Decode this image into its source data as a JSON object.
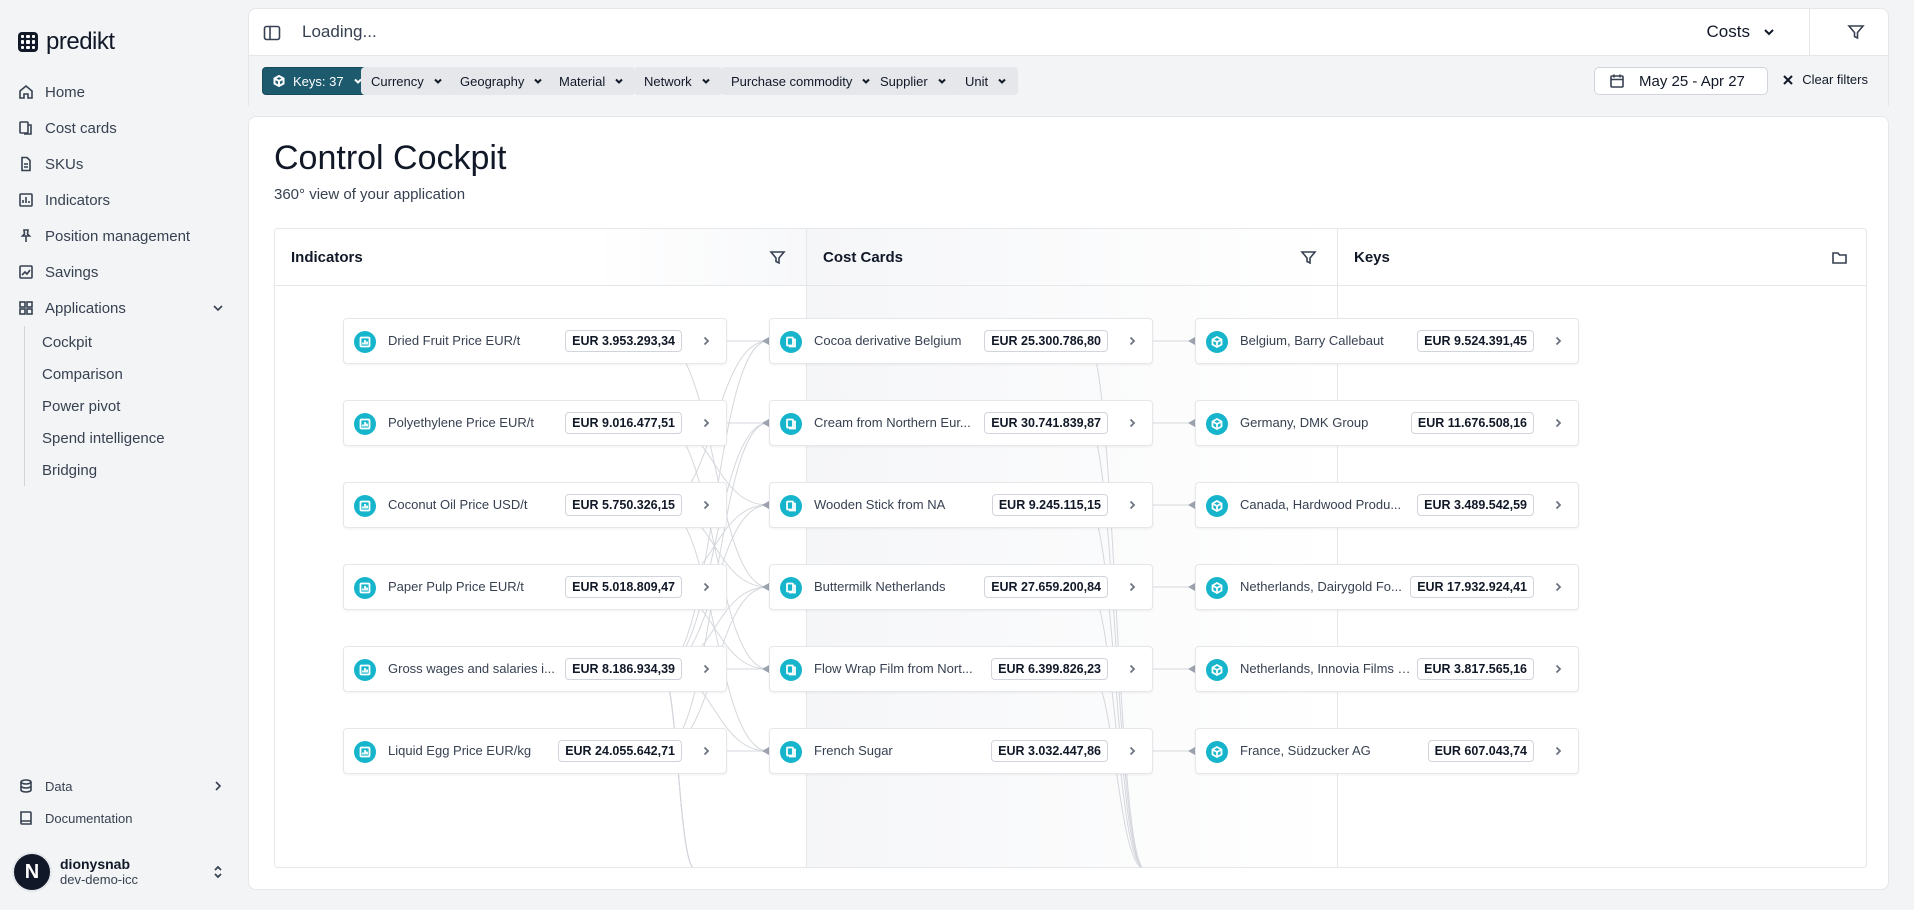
{
  "brand": {
    "name": "predikt"
  },
  "nav": {
    "items": [
      {
        "label": "Home",
        "icon": "home-icon"
      },
      {
        "label": "Cost cards",
        "icon": "cost-cards-icon"
      },
      {
        "label": "SKUs",
        "icon": "document-icon"
      },
      {
        "label": "Indicators",
        "icon": "chart-icon"
      },
      {
        "label": "Position management",
        "icon": "pin-icon"
      },
      {
        "label": "Savings",
        "icon": "savings-chart-icon"
      },
      {
        "label": "Applications",
        "icon": "grid-icon"
      }
    ],
    "applications": [
      "Cockpit",
      "Comparison",
      "Power pivot",
      "Spend intelligence",
      "Bridging"
    ],
    "bottom": [
      {
        "label": "Data",
        "icon": "database-icon"
      },
      {
        "label": "Documentation",
        "icon": "book-icon"
      }
    ]
  },
  "user": {
    "initial": "N",
    "name": "dionysnab",
    "org": "dev-demo-icc"
  },
  "topbar": {
    "status": "Loading...",
    "selector": "Costs"
  },
  "filters": {
    "keys": "Keys: 37",
    "chips": [
      "Currency",
      "Geography",
      "Material",
      "Network",
      "Purchase commodity",
      "Supplier",
      "Unit"
    ],
    "date_range": "May 25 - Apr 27",
    "clear": "Clear filters"
  },
  "page": {
    "title": "Control Cockpit",
    "subtitle": "360° view of your application"
  },
  "columns": {
    "indicators": {
      "title": "Indicators",
      "items": [
        {
          "label": "Dried Fruit Price EUR/t",
          "value": "EUR 3.953.293,34"
        },
        {
          "label": "Polyethylene Price EUR/t",
          "value": "EUR 9.016.477,51"
        },
        {
          "label": "Coconut Oil Price USD/t",
          "value": "EUR 5.750.326,15"
        },
        {
          "label": "Paper Pulp Price EUR/t",
          "value": "EUR 5.018.809,47"
        },
        {
          "label": "Gross wages and salaries i...",
          "value": "EUR 8.186.934,39"
        },
        {
          "label": "Liquid Egg Price EUR/kg",
          "value": "EUR 24.055.642,71"
        }
      ]
    },
    "cost_cards": {
      "title": "Cost Cards",
      "items": [
        {
          "label": "Cocoa derivative Belgium",
          "value": "EUR 25.300.786,80"
        },
        {
          "label": "Cream from Northern Eur...",
          "value": "EUR 30.741.839,87"
        },
        {
          "label": "Wooden Stick from NA",
          "value": "EUR 9.245.115,15"
        },
        {
          "label": "Buttermilk Netherlands",
          "value": "EUR 27.659.200,84"
        },
        {
          "label": "Flow Wrap Film from Nort...",
          "value": "EUR 6.399.826,23"
        },
        {
          "label": "French Sugar",
          "value": "EUR 3.032.447,86"
        }
      ]
    },
    "keys": {
      "title": "Keys",
      "items": [
        {
          "label": "Belgium, Barry Callebaut",
          "value": "EUR 9.524.391,45"
        },
        {
          "label": "Germany, DMK Group",
          "value": "EUR 11.676.508,16"
        },
        {
          "label": "Canada, Hardwood Produ...",
          "value": "EUR 3.489.542,59"
        },
        {
          "label": "Netherlands, Dairygold Fo...",
          "value": "EUR 17.932.924,41"
        },
        {
          "label": "Netherlands, Innovia Films B...",
          "value": "EUR 3.817.565,16"
        },
        {
          "label": "France, Südzucker AG",
          "value": "EUR 607.043,74"
        }
      ]
    }
  },
  "colors": {
    "accent": "#16b5cc",
    "active_chip": "#1e5a6e"
  }
}
